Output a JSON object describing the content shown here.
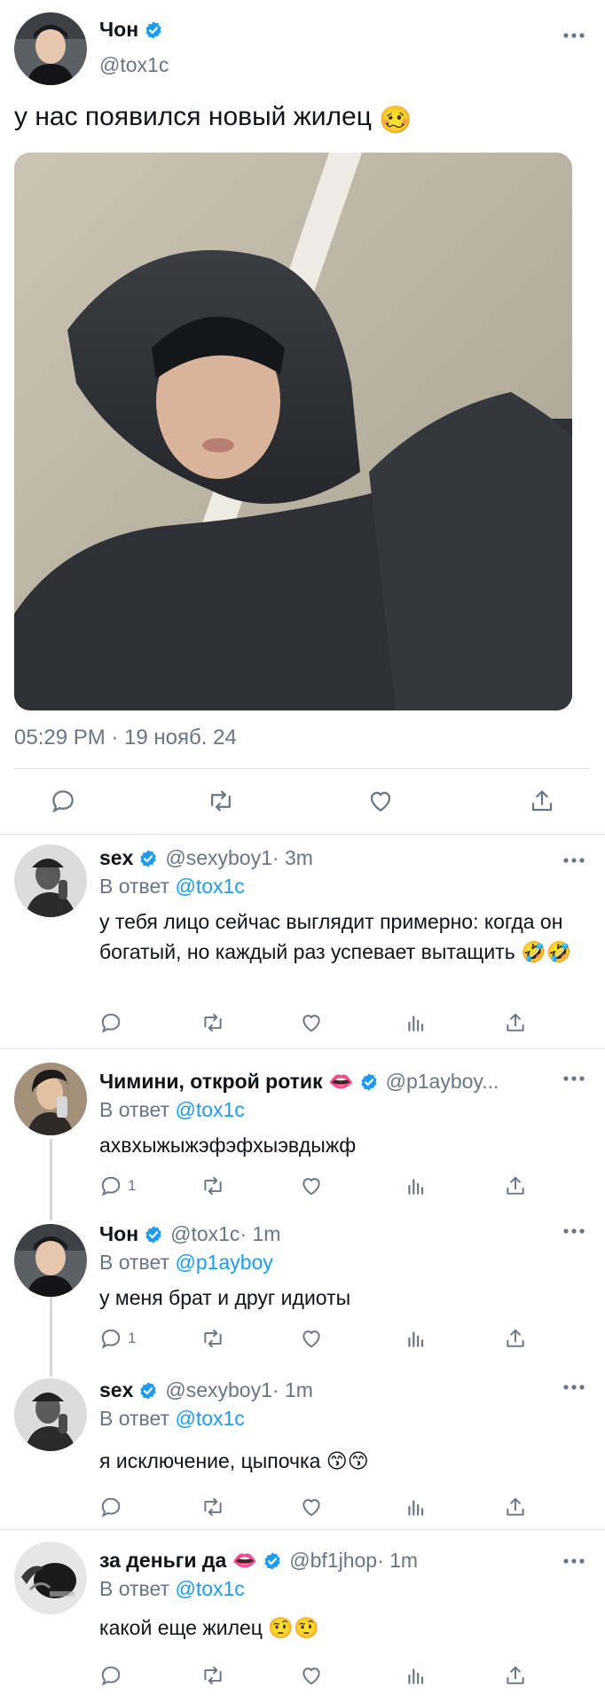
{
  "main": {
    "name": "Чон",
    "handle": "@tox1c",
    "text": "у нас появился новый жилец",
    "text_emoji": "🥴",
    "timestamp": "05:29 PM · 19 нояб. 24"
  },
  "replies": [
    {
      "name": "sex",
      "handle": "@sexyboy1",
      "time": " · 3m",
      "reply_label": "В ответ",
      "reply_mention": "@tox1c",
      "text": "у тебя лицо сейчас выглядит примерно: когда он богатый, но каждый раз успевает вытащить 🤣🤣",
      "reply_count": ""
    },
    {
      "name": "Чимини, открой ротик 👄",
      "handle": "@p1ayboy...",
      "time": "",
      "reply_label": "В ответ",
      "reply_mention": "@tox1c",
      "text": "ахвхыжыжэфэфхыэвдыжф",
      "reply_count": "1"
    },
    {
      "name": "Чон",
      "handle": "@tox1c",
      "time": " · 1m",
      "reply_label": "В ответ",
      "reply_mention": "@p1ayboy",
      "text": "у меня брат и друг идиоты",
      "reply_count": "1"
    },
    {
      "name": "sex",
      "handle": "@sexyboy1",
      "time": " · 1m",
      "reply_label": "В ответ",
      "reply_mention": "@tox1c",
      "text": "я исключение, цыпочка 😙😙",
      "reply_count": ""
    },
    {
      "name": "за деньги да 👄",
      "handle": "@bf1jhop",
      "time": " · 1m",
      "reply_label": "В ответ",
      "reply_mention": "@tox1c",
      "text": "какой еще жилец 🤨🤨",
      "reply_count": ""
    }
  ],
  "icons": {
    "verified": "verified-badge-icon",
    "more": "more-dots-icon",
    "reply": "reply-bubble-icon",
    "retweet": "retweet-icon",
    "like": "heart-icon",
    "stats": "stats-icon",
    "share": "share-icon"
  },
  "colors": {
    "accent": "#1d9bf0",
    "secondary_text": "#687684",
    "divider": "#e1e6ea"
  }
}
